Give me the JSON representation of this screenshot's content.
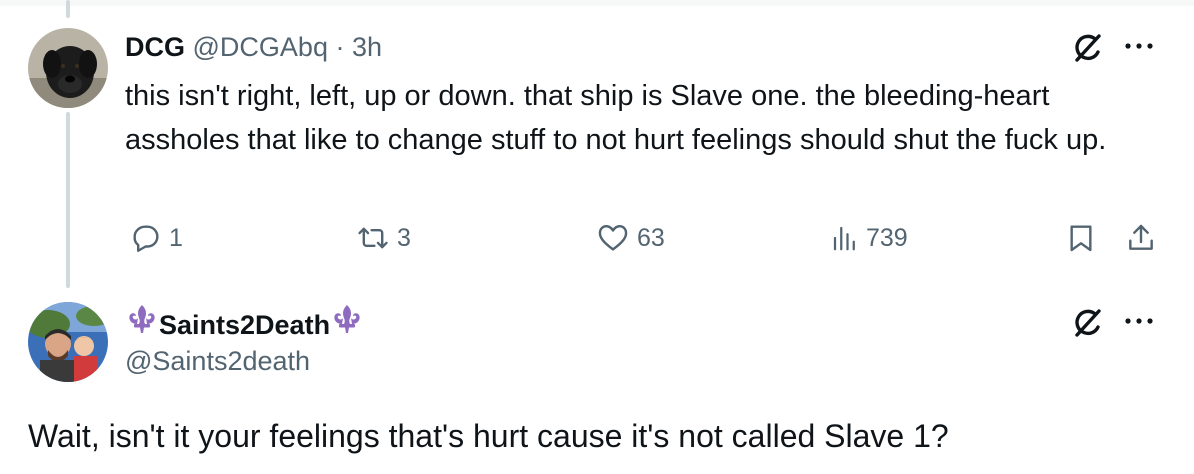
{
  "tweet1": {
    "display_name": "DCG",
    "handle": "@DCGAbq",
    "separator": "·",
    "time": "3h",
    "text": "this isn't right, left, up or down. that ship is Slave one. the bleeding-heart assholes that like to change stuff to not hurt feelings should shut the fuck up.",
    "avatar_icon": "dog-avatar",
    "actions": {
      "replies": "1",
      "reposts": "3",
      "likes": "63",
      "views": "739"
    }
  },
  "tweet2": {
    "display_name": "Saints2Death",
    "handle": "@Saints2death",
    "text": "Wait, isn't it your feelings that's hurt cause it's not called Slave 1?",
    "avatar_icon": "person-with-child-avatar",
    "name_decoration_icon": "fleur-de-lis-icon"
  },
  "colors": {
    "primary_text": "#0f1419",
    "secondary_text": "#536471",
    "thread_line": "#cfd9de",
    "fleur_de_lis": "#8e6bbf"
  }
}
